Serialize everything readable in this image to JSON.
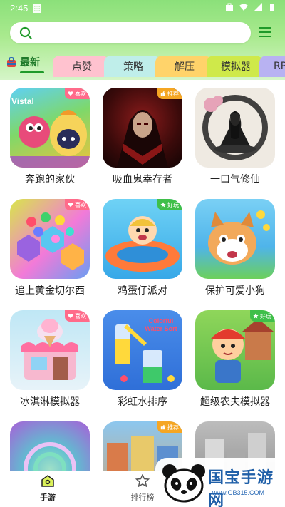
{
  "status": {
    "time": "2:45"
  },
  "search": {
    "placeholder": ""
  },
  "tabs": [
    {
      "label": "最新"
    },
    {
      "label": "点赞"
    },
    {
      "label": "策略"
    },
    {
      "label": "解压"
    },
    {
      "label": "模拟器"
    },
    {
      "label": "RP"
    }
  ],
  "games": [
    {
      "title": "奔跑的家伙",
      "badge": "喜欢"
    },
    {
      "title": "吸血鬼幸存者",
      "badge": "推荐"
    },
    {
      "title": "一口气修仙",
      "badge": ""
    },
    {
      "title": "追上黄金切尔西",
      "badge": "喜欢"
    },
    {
      "title": "鸡蛋仔派对",
      "badge": "好玩"
    },
    {
      "title": "保护可爱小狗",
      "badge": ""
    },
    {
      "title": "冰淇淋模拟器",
      "badge": "喜欢"
    },
    {
      "title": "彩虹水排序",
      "badge": ""
    },
    {
      "title": "超级农夫模拟器",
      "badge": "好玩"
    },
    {
      "title": "",
      "badge": ""
    },
    {
      "title": "",
      "badge": "推荐"
    },
    {
      "title": "",
      "badge": ""
    }
  ],
  "thumb_texts": {
    "vistal": "Vistal",
    "colorful": "Colorful Water Sort"
  },
  "bottom_nav": [
    {
      "label": "手游"
    },
    {
      "label": "排行榜"
    }
  ],
  "watermark": {
    "text": "国宝手游网",
    "url": "www.GB315.COM"
  },
  "colors": {
    "accent": "#1f9a2a",
    "header": "#a9ea8e",
    "like_badge": "#ff6b8a",
    "rec_badge": "#f5a623",
    "fun_badge": "#3fbf4a"
  }
}
